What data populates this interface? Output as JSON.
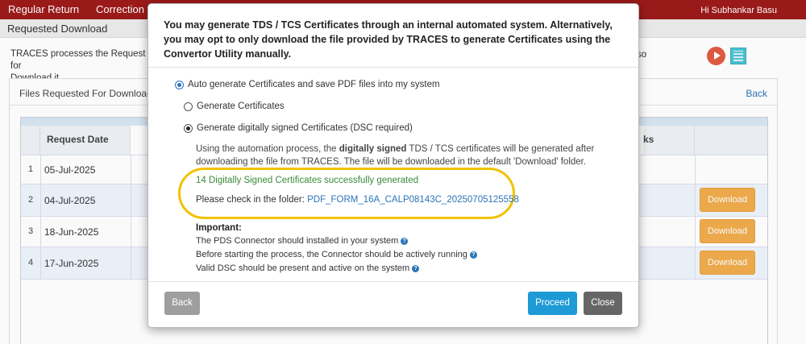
{
  "topnav": {
    "items": [
      "Regular Return",
      "Correction"
    ],
    "greeting": "Hi Subhankar Basu"
  },
  "subheader": {
    "title": "Requested Download"
  },
  "info": {
    "text": "TRACES processes the Request for",
    "text2": "Download it.",
    "tail": "so"
  },
  "panel": {
    "title": "Files Requested For Download",
    "back_label": "Back"
  },
  "table": {
    "headers": [
      "Request Date",
      "ks"
    ],
    "rows": [
      {
        "num": "1",
        "date": "05-Jul-2025",
        "action": ""
      },
      {
        "num": "2",
        "date": "04-Jul-2025",
        "action": "Download"
      },
      {
        "num": "3",
        "date": "18-Jun-2025",
        "action": "Download"
      },
      {
        "num": "4",
        "date": "17-Jun-2025",
        "action": "Download"
      }
    ]
  },
  "modal": {
    "title": "You may generate TDS / TCS Certificates through an internal automated system. Alternatively, you may opt to only download the file provided by TRACES to generate Certificates using the Convertor Utility manually.",
    "option_auto": "Auto generate Certificates and save PDF files into my system",
    "option_generate": "Generate Certificates",
    "option_dsc": "Generate digitally signed Certificates (DSC required)",
    "desc_part1": "Using the automation process, the ",
    "desc_bold": "digitally signed",
    "desc_part2": " TDS / TCS certificates will be generated after downloading the file from TRACES. The file will be downloaded in the default 'Download' folder.",
    "success": "14 Digitally Signed Certificates successfully generated",
    "folder_label": "Please check in the folder: ",
    "folder_link": "PDF_FORM_16A_CALP08143C_20250705125558",
    "important_title": "Important:",
    "important": [
      "The PDS Connector should installed in your system",
      "Before starting the process, the Connector should be actively running",
      "Valid DSC should be present and active on the system"
    ],
    "back_button": "Back",
    "proceed_button": "Proceed",
    "close_button": "Close"
  },
  "colors": {
    "nav": "#9e1b1b",
    "proceed": "#1e9ad6",
    "download": "#f0ad4e",
    "highlight": "#f2c200",
    "success": "#3a8a3a"
  }
}
